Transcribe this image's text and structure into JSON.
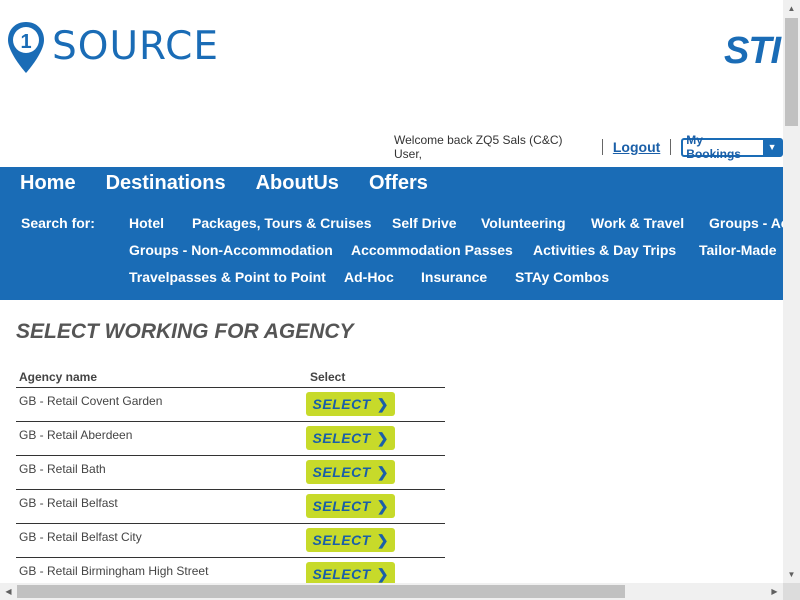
{
  "header": {
    "logo_text": "SOURCE",
    "brand_right": "STI",
    "welcome": "Welcome back ZQ5 Sals (C&C) User,",
    "logout": "Logout",
    "my_bookings": "My Bookings",
    "accent": "#1a6cb6"
  },
  "nav": {
    "main": [
      "Home",
      "Destinations",
      "AboutUs",
      "Offers"
    ],
    "search_for": "Search for:",
    "sub_row1": [
      "Hotel",
      "Packages, Tours & Cruises",
      "Self Drive",
      "Volunteering",
      "Work & Travel",
      "Groups - Ac"
    ],
    "sub_row2": [
      "Groups - Non-Accommodation",
      "Accommodation Passes",
      "Activities & Day Trips",
      "Tailor-Made"
    ],
    "sub_row3": [
      "Travelpasses & Point to Point",
      "Ad-Hoc",
      "Insurance",
      "STAy Combos"
    ]
  },
  "main": {
    "title": "SELECT WORKING FOR AGENCY",
    "col_agency": "Agency name",
    "col_select": "Select",
    "select_label": "SELECT",
    "rows": [
      "GB - Retail Covent Garden",
      "GB - Retail Aberdeen",
      "GB - Retail Bath",
      "GB - Retail Belfast",
      "GB - Retail Belfast City",
      "GB - Retail Birmingham High Street"
    ]
  }
}
